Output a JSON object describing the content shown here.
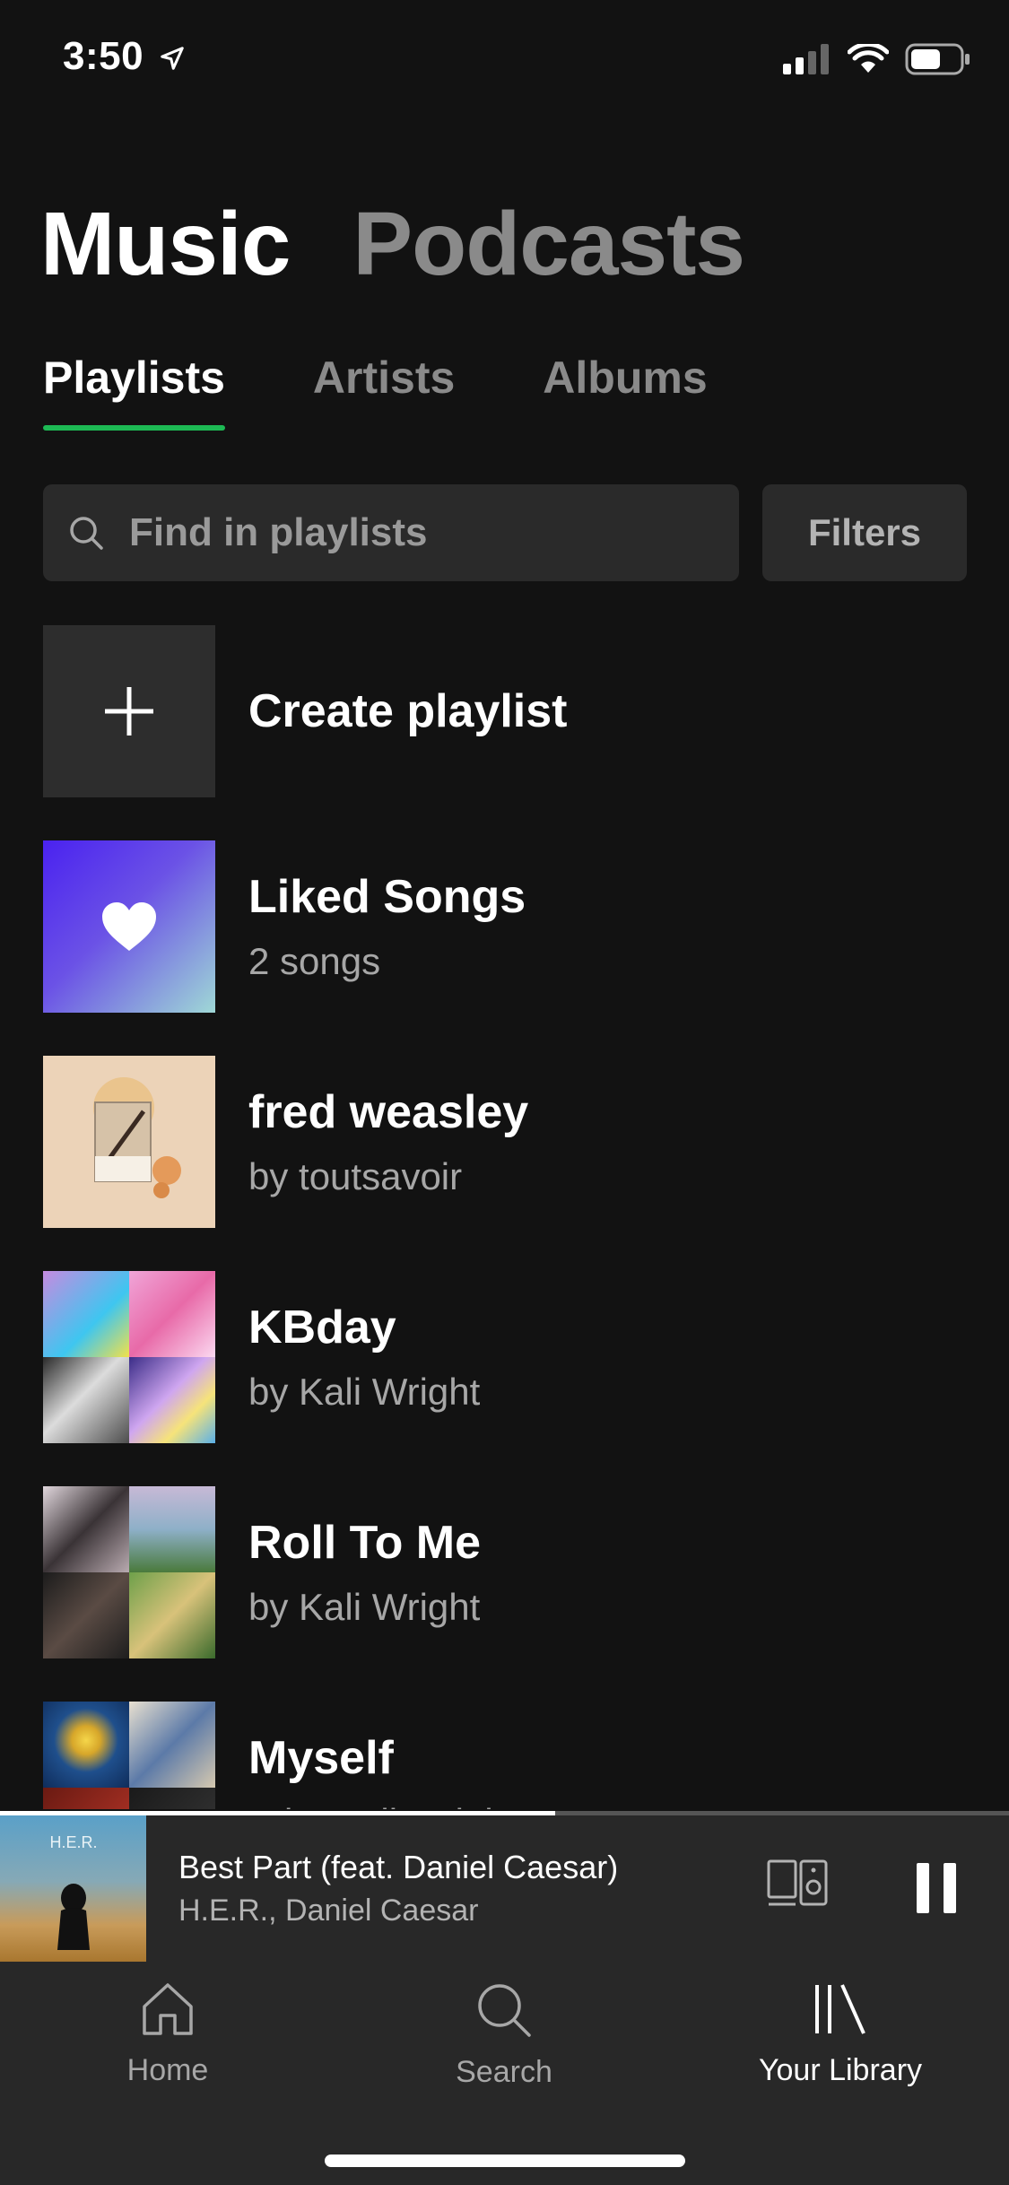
{
  "status": {
    "time": "3:50"
  },
  "header": {
    "tabs": [
      {
        "label": "Music",
        "active": true
      },
      {
        "label": "Podcasts",
        "active": false
      }
    ],
    "subtabs": [
      {
        "label": "Playlists",
        "active": true
      },
      {
        "label": "Artists",
        "active": false
      },
      {
        "label": "Albums",
        "active": false
      }
    ]
  },
  "search": {
    "placeholder": "Find in playlists",
    "filters_label": "Filters"
  },
  "list": [
    {
      "title": "Create playlist",
      "subtitle": ""
    },
    {
      "title": "Liked Songs",
      "subtitle": "2 songs"
    },
    {
      "title": "fred weasley",
      "subtitle": "by toutsavoir"
    },
    {
      "title": "KBday",
      "subtitle": "by Kali Wright"
    },
    {
      "title": "Roll To Me",
      "subtitle": "by Kali Wright"
    },
    {
      "title": "Myself",
      "subtitle": "by Kali Wright"
    }
  ],
  "now_playing": {
    "title": "Best Part (feat. Daniel Caesar)",
    "artist": "H.E.R., Daniel Caesar",
    "progress": 0.55
  },
  "nav": [
    {
      "label": "Home",
      "icon": "home-icon",
      "active": false
    },
    {
      "label": "Search",
      "icon": "search-icon",
      "active": false
    },
    {
      "label": "Your Library",
      "icon": "library-icon",
      "active": true
    }
  ],
  "colors": {
    "accent": "#1db954",
    "background": "#121212",
    "surface": "#282828"
  }
}
